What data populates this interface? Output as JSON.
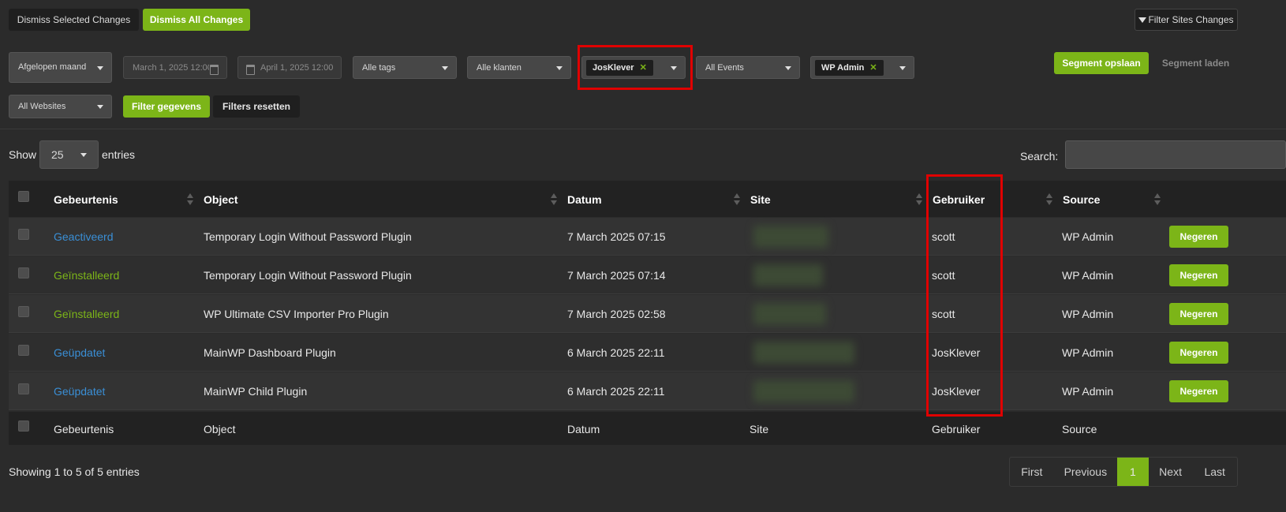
{
  "top_bar": {
    "dismiss_selected": "Dismiss Selected Changes",
    "dismiss_all": "Dismiss All Changes",
    "filter_sites_changes": "Filter Sites Changes"
  },
  "filters": {
    "period": "Afgelopen maand",
    "date_from_placeholder": "March 1, 2025 12:00",
    "date_to_placeholder": "April 1, 2025 12:00",
    "tags": "Alle tags",
    "clients": "Alle klanten",
    "user_chip": "JosKlever",
    "events": "All Events",
    "source_chip": "WP Admin",
    "websites": "All Websites",
    "filter_button": "Filter gegevens",
    "reset_button": "Filters resetten",
    "segment_save": "Segment opslaan",
    "segment_load": "Segment laden"
  },
  "table_controls": {
    "show_label": "Show",
    "page_length": "25",
    "entries_label": "entries",
    "search_label": "Search:",
    "search_value": ""
  },
  "table": {
    "headers": {
      "event": "Gebeurtenis",
      "object": "Object",
      "date": "Datum",
      "site": "Site",
      "user": "Gebruiker",
      "source": "Source"
    },
    "rows": [
      {
        "event": "Geactiveerd",
        "event_color": "#3a8fd6",
        "object": "Temporary Login Without Password Plugin",
        "date": "7 March 2025 07:15",
        "user": "scott",
        "source": "WP Admin",
        "action": "Negeren"
      },
      {
        "event": "Geïnstalleerd",
        "event_color": "#7cb518",
        "object": "Temporary Login Without Password Plugin",
        "date": "7 March 2025 07:14",
        "user": "scott",
        "source": "WP Admin",
        "action": "Negeren"
      },
      {
        "event": "Geïnstalleerd",
        "event_color": "#7cb518",
        "object": "WP Ultimate CSV Importer Pro Plugin",
        "date": "7 March 2025 02:58",
        "user": "scott",
        "source": "WP Admin",
        "action": "Negeren"
      },
      {
        "event": "Geüpdatet",
        "event_color": "#3a8fd6",
        "object": "MainWP Dashboard Plugin",
        "date": "6 March 2025 22:11",
        "user": "JosKlever",
        "source": "WP Admin",
        "action": "Negeren"
      },
      {
        "event": "Geüpdatet",
        "event_color": "#3a8fd6",
        "object": "MainWP Child Plugin",
        "date": "6 March 2025 22:11",
        "user": "JosKlever",
        "source": "WP Admin",
        "action": "Negeren"
      }
    ],
    "footer": {
      "event": "Gebeurtenis",
      "object": "Object",
      "date": "Datum",
      "site": "Site",
      "user": "Gebruiker",
      "source": "Source"
    }
  },
  "pagination": {
    "info": "Showing 1 to 5 of 5 entries",
    "first": "First",
    "previous": "Previous",
    "current": "1",
    "next": "Next",
    "last": "Last"
  },
  "colors": {
    "accent_green": "#7cb518",
    "link_blue": "#3a8fd6",
    "highlight_red": "#e00000"
  }
}
